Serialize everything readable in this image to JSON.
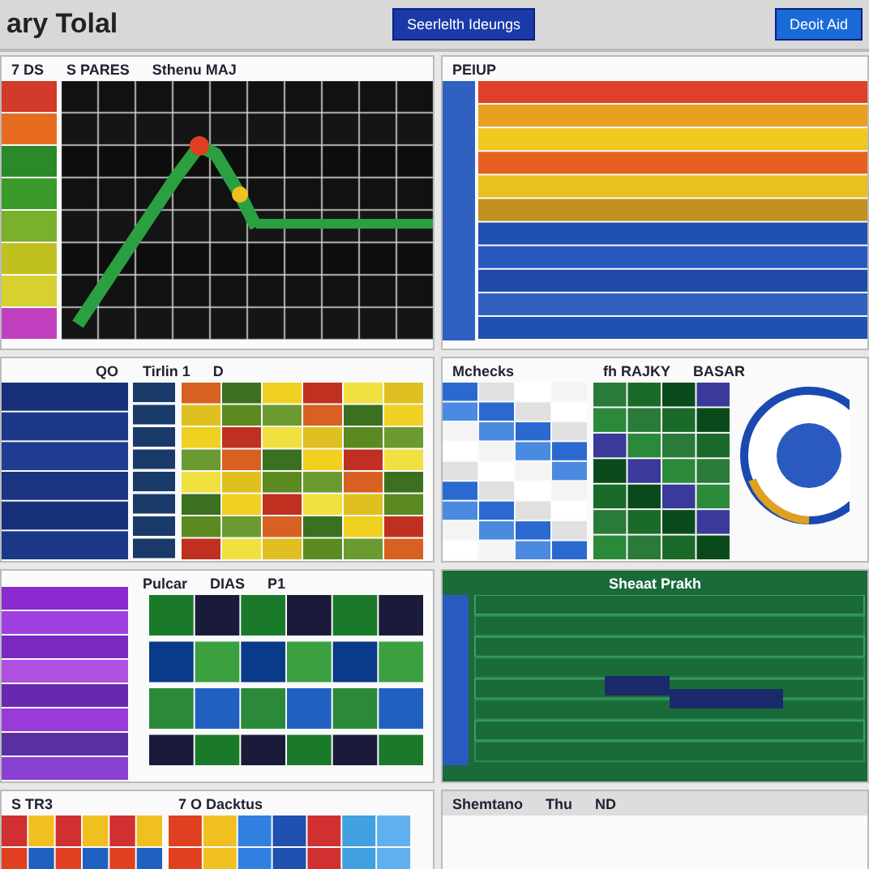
{
  "header": {
    "title": "ary Tolal",
    "center_button": "Seerlelth Ideungs",
    "right_button": "Deoit Aid"
  },
  "panels": [
    {
      "labels": [
        "7 DS",
        "S PARES",
        "Sthenu MAJ"
      ]
    },
    {
      "labels": [
        "PEIUP"
      ]
    },
    {
      "labels": [
        "QO"
      ]
    },
    {
      "labels": [
        "Tirlin 1",
        "D"
      ]
    },
    {
      "labels": [
        "Mchecks"
      ]
    },
    {
      "labels": [
        "fh RAJKY",
        "BASAR"
      ]
    },
    {
      "labels": [
        "Pulcar",
        "DIAS",
        "P1"
      ]
    },
    {
      "labels": [
        "Sheaat Prakh"
      ]
    },
    {
      "labels": [
        "S TR3"
      ]
    },
    {
      "labels": [
        "7 O Dacktus"
      ]
    },
    {
      "labels": [
        "Shemtano",
        "Thu",
        "ND"
      ]
    }
  ]
}
